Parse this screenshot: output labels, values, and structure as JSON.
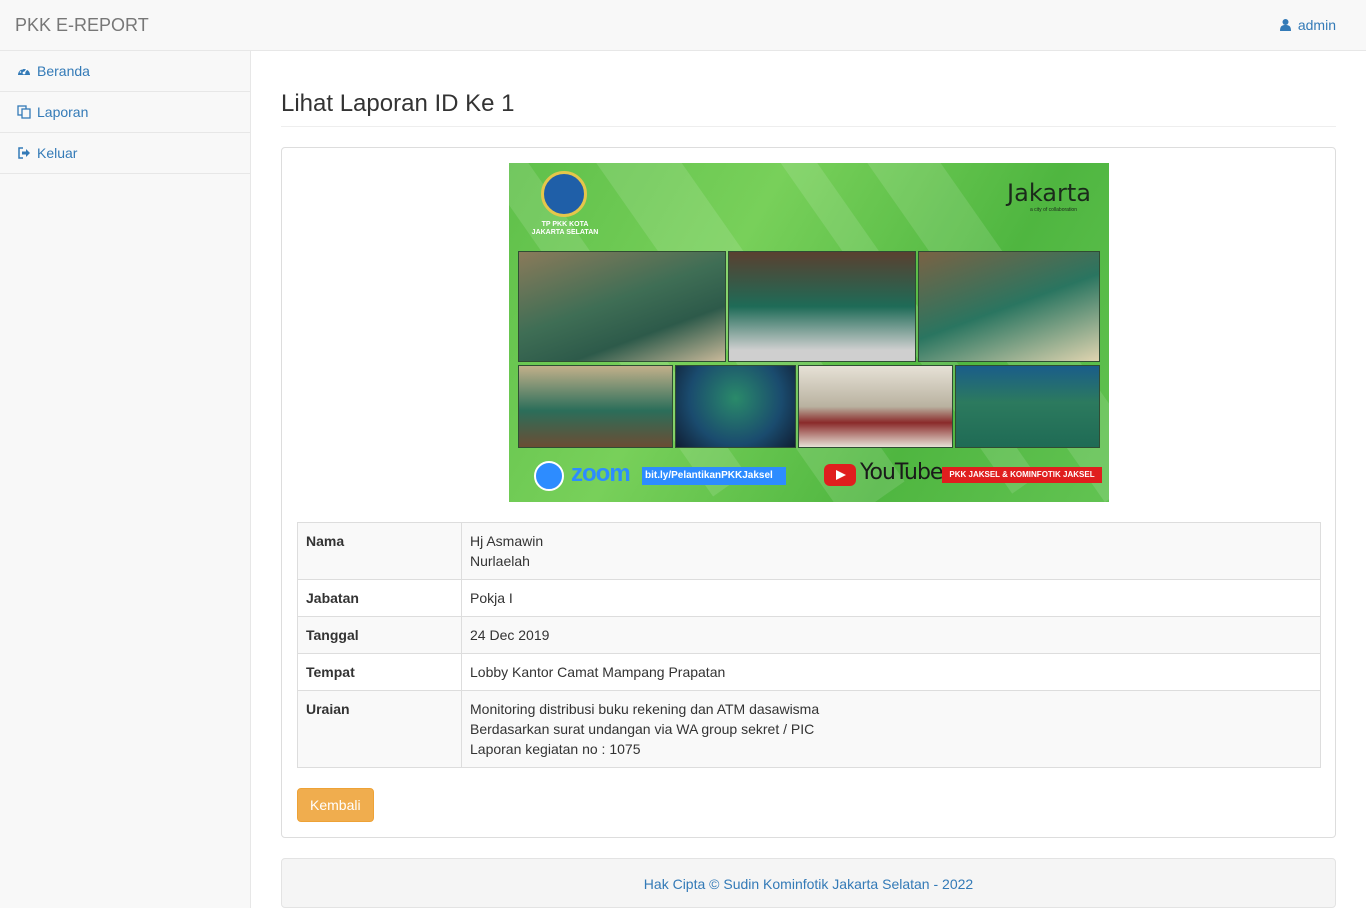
{
  "app": {
    "brand": "PKK E-REPORT"
  },
  "header": {
    "user": "admin",
    "user_icon": "user-icon"
  },
  "sidebar": {
    "items": [
      {
        "label": "Beranda",
        "icon": "dashboard-icon"
      },
      {
        "label": "Laporan",
        "icon": "copy-icon"
      },
      {
        "label": "Keluar",
        "icon": "sign-out-icon"
      }
    ]
  },
  "main": {
    "title": "Lihat Laporan ID Ke 1",
    "image": {
      "logo_text": "TP PKK KOTA JAKARTA SELATAN",
      "jakarta_brand": "Jakarta",
      "jakarta_tagline": "a city of collaboration",
      "zoom_word": "zoom",
      "zoom_link": "bit.ly/PelantikanPKKJaksel",
      "youtube_word": "YouTube",
      "youtube_channel": "PKK JAKSEL & KOMINFOTIK JAKSEL"
    },
    "details": {
      "nama": {
        "label": "Nama",
        "lines": [
          "Hj Asmawin",
          "Nurlaelah"
        ]
      },
      "jabatan": {
        "label": "Jabatan",
        "value": "Pokja I"
      },
      "tanggal": {
        "label": "Tanggal",
        "value": "24 Dec 2019"
      },
      "tempat": {
        "label": "Tempat",
        "value": "Lobby Kantor Camat Mampang Prapatan"
      },
      "uraian": {
        "label": "Uraian",
        "lines": [
          "Monitoring distribusi buku rekening dan ATM dasawisma",
          "Berdasarkan surat undangan via WA group sekret / PIC",
          "Laporan kegiatan no : 1075"
        ]
      }
    },
    "back_button": "Kembali"
  },
  "footer": {
    "text": "Hak Cipta © Sudin Kominfotik Jakarta Selatan - 2022"
  },
  "colors": {
    "link": "#337ab7",
    "warning": "#f0ad4e",
    "image_green": "#5fc04a"
  }
}
